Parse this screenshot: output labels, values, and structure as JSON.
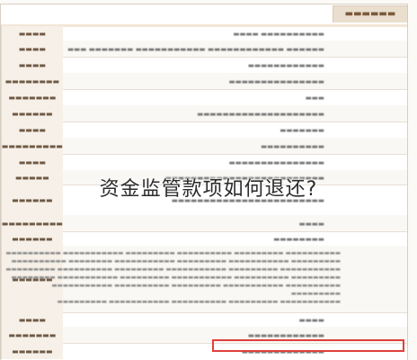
{
  "overlay": {
    "caption": "资金监管款项如何退还?"
  },
  "colors": {
    "header_bg": "#eadfcf",
    "label_bg": "#f6f0e8",
    "highlight_border": "#e0403a"
  }
}
